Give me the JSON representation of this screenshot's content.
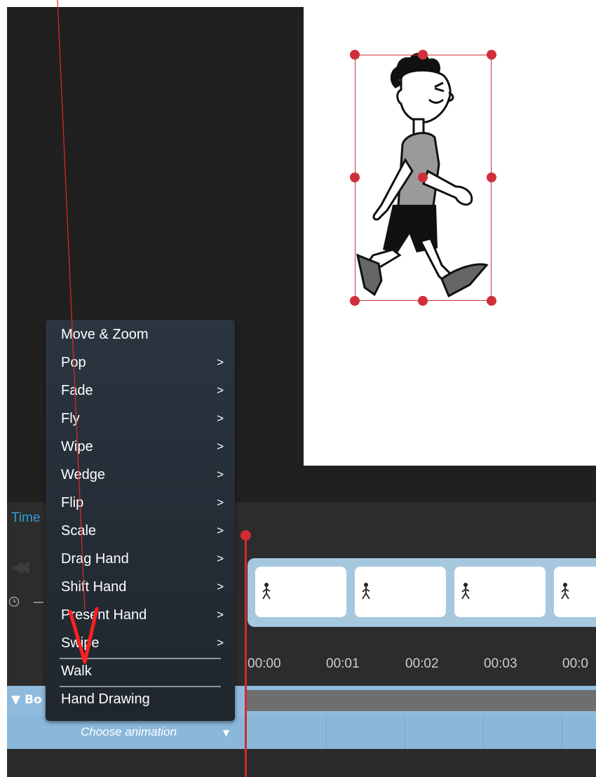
{
  "timeline": {
    "title": "Time",
    "track_label": "Bo",
    "ruler": [
      "00:00",
      "00:01",
      "00:02",
      "00:03",
      "00:0"
    ]
  },
  "context_menu": {
    "items": [
      {
        "label": "Move & Zoom",
        "chevron": ""
      },
      {
        "label": "Pop",
        "chevron": ">"
      },
      {
        "label": "Fade",
        "chevron": ">"
      },
      {
        "label": "Fly",
        "chevron": ">"
      },
      {
        "label": "Wipe",
        "chevron": ">"
      },
      {
        "label": "Wedge",
        "chevron": ">"
      },
      {
        "label": "Flip",
        "chevron": ">"
      },
      {
        "label": "Scale",
        "chevron": ">"
      },
      {
        "label": "Drag Hand",
        "chevron": ">"
      },
      {
        "label": "Shift Hand",
        "chevron": ">"
      },
      {
        "label": "Present Hand",
        "chevron": ">"
      },
      {
        "label": "Swipe",
        "chevron": ">"
      },
      {
        "label": "Walk",
        "chevron": ""
      },
      {
        "label": "Hand Drawing",
        "chevron": ""
      }
    ]
  },
  "animation_select": {
    "label": "Choose animation",
    "arrow": "▼"
  },
  "icons": {
    "rewind": "rewind-icon",
    "clock": "clock-icon",
    "annotation": "red-check-annotation"
  },
  "colors": {
    "accent_red": "#d12a33",
    "timeline_blue": "#8fbadc",
    "title_blue": "#2f9fd6",
    "menu_bg": "#253039"
  }
}
